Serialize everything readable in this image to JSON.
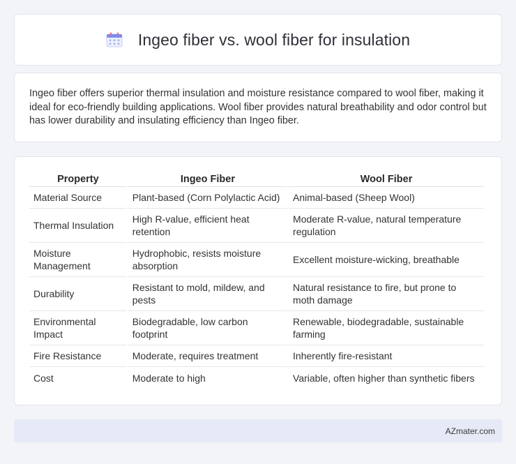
{
  "header": {
    "icon": "calendar-icon",
    "title": "Ingeo fiber vs. wool fiber for insulation"
  },
  "summary": {
    "text": "Ingeo fiber offers superior thermal insulation and moisture resistance compared to wool fiber, making it ideal for eco-friendly building applications. Wool fiber provides natural breathability and odor control but has lower durability and insulating efficiency than Ingeo fiber."
  },
  "table": {
    "headers": [
      "Property",
      "Ingeo Fiber",
      "Wool Fiber"
    ],
    "rows": [
      [
        "Material Source",
        "Plant-based (Corn Polylactic Acid)",
        "Animal-based (Sheep Wool)"
      ],
      [
        "Thermal Insulation",
        "High R-value, efficient heat retention",
        "Moderate R-value, natural temperature regulation"
      ],
      [
        "Moisture Management",
        "Hydrophobic, resists moisture absorption",
        "Excellent moisture-wicking, breathable"
      ],
      [
        "Durability",
        "Resistant to mold, mildew, and pests",
        "Natural resistance to fire, but prone to moth damage"
      ],
      [
        "Environmental Impact",
        "Biodegradable, low carbon footprint",
        "Renewable, biodegradable, sustainable farming"
      ],
      [
        "Fire Resistance",
        "Moderate, requires treatment",
        "Inherently fire-resistant"
      ],
      [
        "Cost",
        "Moderate to high",
        "Variable, often higher than synthetic fibers"
      ]
    ]
  },
  "footer": {
    "text": "AZmater.com"
  }
}
